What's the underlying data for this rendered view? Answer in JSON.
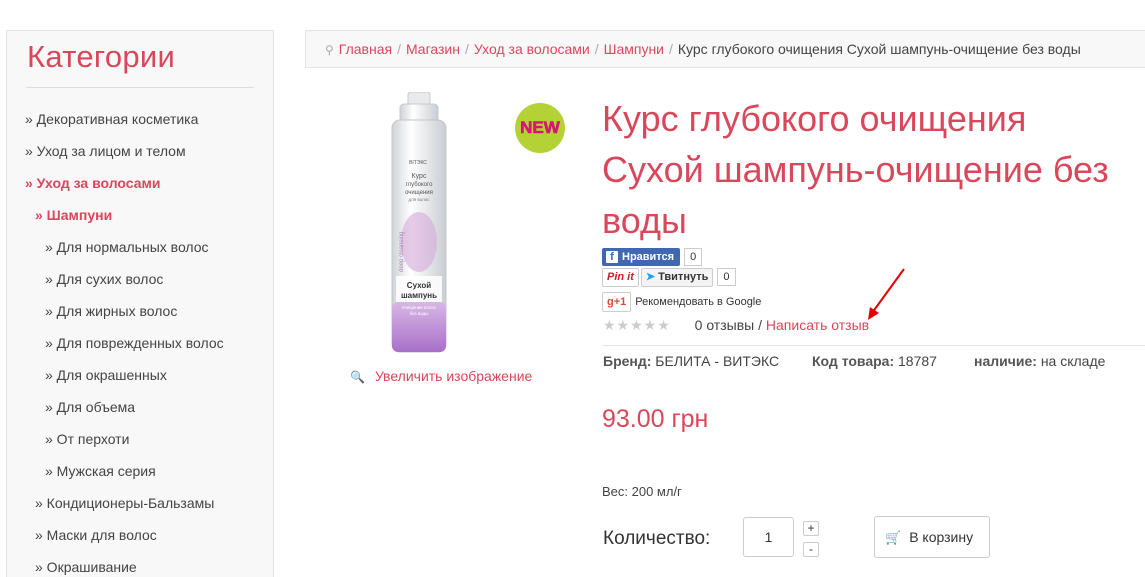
{
  "sidebar": {
    "title": "Категории",
    "items": [
      {
        "label": "» Декоративная косметика",
        "active": false,
        "level": 0
      },
      {
        "label": "» Уход за лицом и телом",
        "active": false,
        "level": 0
      },
      {
        "label": "» Уход за волосами",
        "active": true,
        "level": 0
      },
      {
        "label": "» Шампуни",
        "active": true,
        "level": 1
      },
      {
        "label": "» Для нормальных волос",
        "active": false,
        "level": 2
      },
      {
        "label": "» Для сухих волос",
        "active": false,
        "level": 2
      },
      {
        "label": "» Для жирных волос",
        "active": false,
        "level": 2
      },
      {
        "label": "» Для поврежденных волос",
        "active": false,
        "level": 2
      },
      {
        "label": "» Для окрашенных",
        "active": false,
        "level": 2
      },
      {
        "label": "» Для объема",
        "active": false,
        "level": 2
      },
      {
        "label": "» От перхоти",
        "active": false,
        "level": 2
      },
      {
        "label": "» Мужская серия",
        "active": false,
        "level": 2
      },
      {
        "label": "» Кондиционеры-Бальзамы",
        "active": false,
        "level": 1
      },
      {
        "label": "» Маски для волос",
        "active": false,
        "level": 1
      },
      {
        "label": "» Окрашивание",
        "active": false,
        "level": 1
      }
    ]
  },
  "breadcrumb": {
    "items": [
      "Главная",
      "Магазин",
      "Уход за волосами",
      "Шампуни"
    ],
    "current": "Курс глубокого очищения Сухой шампунь-очищение без воды",
    "separator": "/"
  },
  "product": {
    "title": "Курс глубокого очищения Сухой шампунь-очищение без воды",
    "badge": "NEW",
    "zoom_label": "Увеличить изображение",
    "image_text": {
      "brand": "ВIТЭКС",
      "line1": "Курс",
      "line2": "глубокого",
      "line3": "очищения",
      "line4": "для волос",
      "vertical": "deep cleansing",
      "name1": "Сухой",
      "name2": "шампунь",
      "sub1": "очищение волос",
      "sub2": "без воды"
    },
    "brand_label": "Бренд:",
    "brand_value": "БЕЛИТА - ВИТЭКС",
    "code_label": "Код товара:",
    "code_value": "18787",
    "stock_label": "наличие:",
    "stock_value": "на складе",
    "price": "93.00 грн",
    "weight": "Вес: 200 мл/г",
    "qty_label": "Количество:",
    "qty_value": "1",
    "qty_plus": "+",
    "qty_minus": "-",
    "cart_label": "В корзину"
  },
  "social": {
    "fb_icon": "f",
    "fb_label": "Нравится",
    "fb_count": "0",
    "pin_label": "Pin it",
    "tw_label": "Твитнуть",
    "tw_count": "0",
    "gplus_label": "g+1",
    "gplus_text": "Рекомендовать в Google"
  },
  "rating": {
    "stars": "★★★★★",
    "reviews": "0 отзывы",
    "divider": "/",
    "write_review": "Написать отзыв"
  },
  "colors": {
    "accent": "#d9475b",
    "badge_bg": "#b4d235",
    "facebook": "#4267b2"
  }
}
